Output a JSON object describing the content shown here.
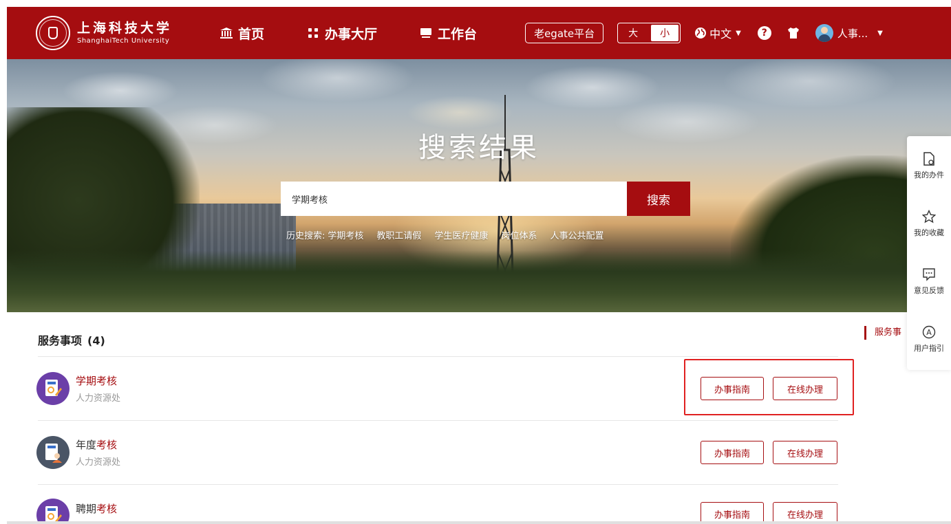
{
  "header": {
    "logo_cn": "上海科技大学",
    "logo_en": "ShanghaiTech University",
    "nav": [
      {
        "label": "首页",
        "icon": "museum-icon"
      },
      {
        "label": "办事大厅",
        "icon": "grid-icon"
      },
      {
        "label": "工作台",
        "icon": "monitor-icon"
      }
    ],
    "old_egate": "老egate平台",
    "size_large": "大",
    "size_small": "小",
    "language": "中文",
    "user_name": "人事...",
    "brand_color": "#a50d10"
  },
  "banner": {
    "title": "搜索结果",
    "search_value": "学期考核",
    "search_button": "搜索",
    "history_label": "历史搜索:",
    "history": [
      "学期考核",
      "教职工请假",
      "学生医疗健康",
      "岗位体系",
      "人事公共配置"
    ]
  },
  "side_toolbar": [
    {
      "label": "我的办件",
      "icon": "document-icon"
    },
    {
      "label": "我的收藏",
      "icon": "star-icon"
    },
    {
      "label": "意见反馈",
      "icon": "feedback-icon"
    },
    {
      "label": "用户指引",
      "icon": "guide-icon"
    }
  ],
  "results": {
    "title": "服务事项",
    "count": "(4)",
    "side_tab": "服务事",
    "items": [
      {
        "name_prefix": "",
        "name_highlight": "学期考核",
        "department": "人力资源处",
        "guide_button": "办事指南",
        "online_button": "在线办理",
        "icon_color": "#6b3fa8"
      },
      {
        "name_prefix": "年度",
        "name_highlight": "考核",
        "department": "人力资源处",
        "guide_button": "办事指南",
        "online_button": "在线办理",
        "icon_color": "#4a5566"
      },
      {
        "name_prefix": "聘期",
        "name_highlight": "考核",
        "department": "",
        "guide_button": "办事指南",
        "online_button": "在线办理",
        "icon_color": "#6b3fa8"
      }
    ]
  }
}
